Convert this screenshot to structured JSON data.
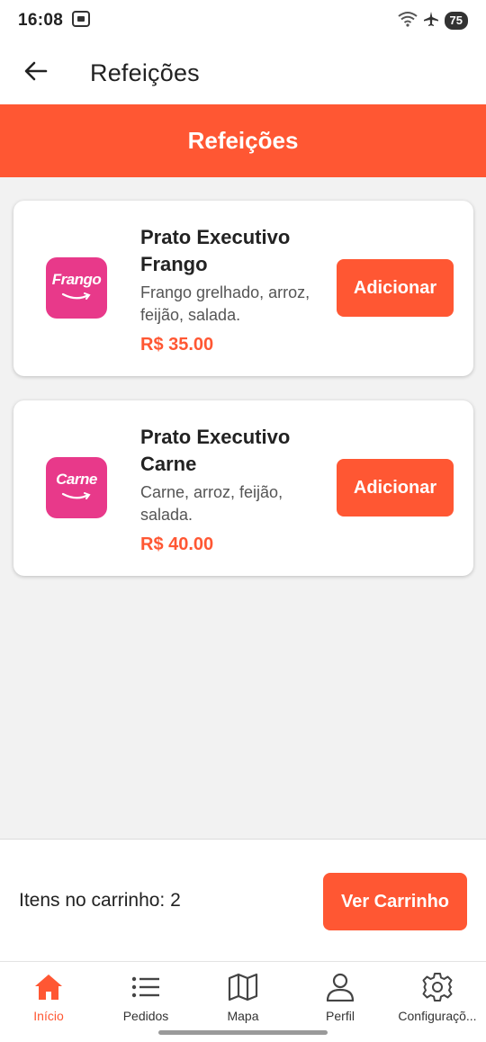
{
  "status_bar": {
    "time": "16:08",
    "battery": "75"
  },
  "app_bar": {
    "title": "Refeições"
  },
  "header": {
    "title": "Refeições"
  },
  "meals": [
    {
      "name": "Prato Executivo Frango",
      "description": "Frango grelhado, arroz, feijão, salada.",
      "price": "R$ 35.00",
      "image_text": "Frango",
      "add_label": "Adicionar"
    },
    {
      "name": "Prato Executivo Carne",
      "description": "Carne, arroz, feijão, salada.",
      "price": "R$ 40.00",
      "image_text": "Carne",
      "add_label": "Adicionar"
    }
  ],
  "cart": {
    "count_text": "Itens no carrinho: 2",
    "button_label": "Ver Carrinho"
  },
  "bottom_nav": {
    "items": [
      {
        "label": "Início",
        "icon": "home-icon",
        "active": true
      },
      {
        "label": "Pedidos",
        "icon": "list-icon",
        "active": false
      },
      {
        "label": "Mapa",
        "icon": "map-icon",
        "active": false
      },
      {
        "label": "Perfil",
        "icon": "person-icon",
        "active": false
      },
      {
        "label": "Configuraçõ...",
        "icon": "gear-icon",
        "active": false
      }
    ]
  },
  "colors": {
    "accent": "#ff5733",
    "image_bg": "#e8398a"
  }
}
